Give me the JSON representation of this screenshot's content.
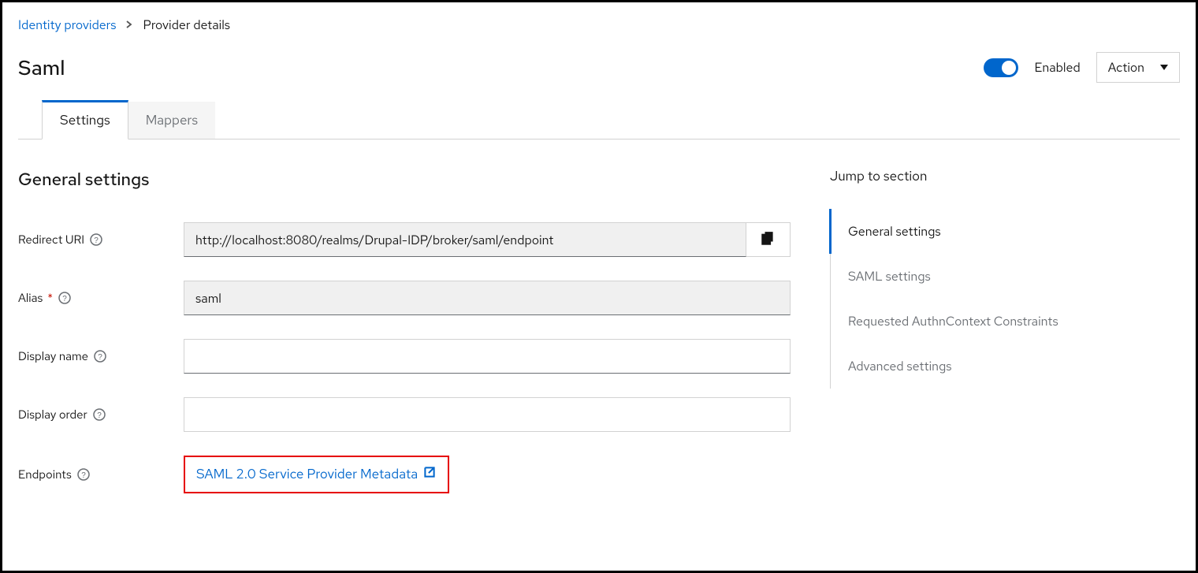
{
  "breadcrumb": {
    "root": "Identity providers",
    "current": "Provider details"
  },
  "page_title": "Saml",
  "header": {
    "enabled_label": "Enabled",
    "action_label": "Action"
  },
  "tabs": {
    "settings": "Settings",
    "mappers": "Mappers"
  },
  "general": {
    "section_title": "General settings",
    "redirect_uri_label": "Redirect URI",
    "redirect_uri_value": "http://localhost:8080/realms/Drupal-IDP/broker/saml/endpoint",
    "alias_label": "Alias",
    "alias_value": "saml",
    "display_name_label": "Display name",
    "display_name_value": "",
    "display_order_label": "Display order",
    "display_order_value": "",
    "endpoints_label": "Endpoints",
    "endpoints_link": "SAML 2.0 Service Provider Metadata"
  },
  "jump": {
    "title": "Jump to section",
    "items": [
      "General settings",
      "SAML settings",
      "Requested AuthnContext Constraints",
      "Advanced settings"
    ]
  }
}
